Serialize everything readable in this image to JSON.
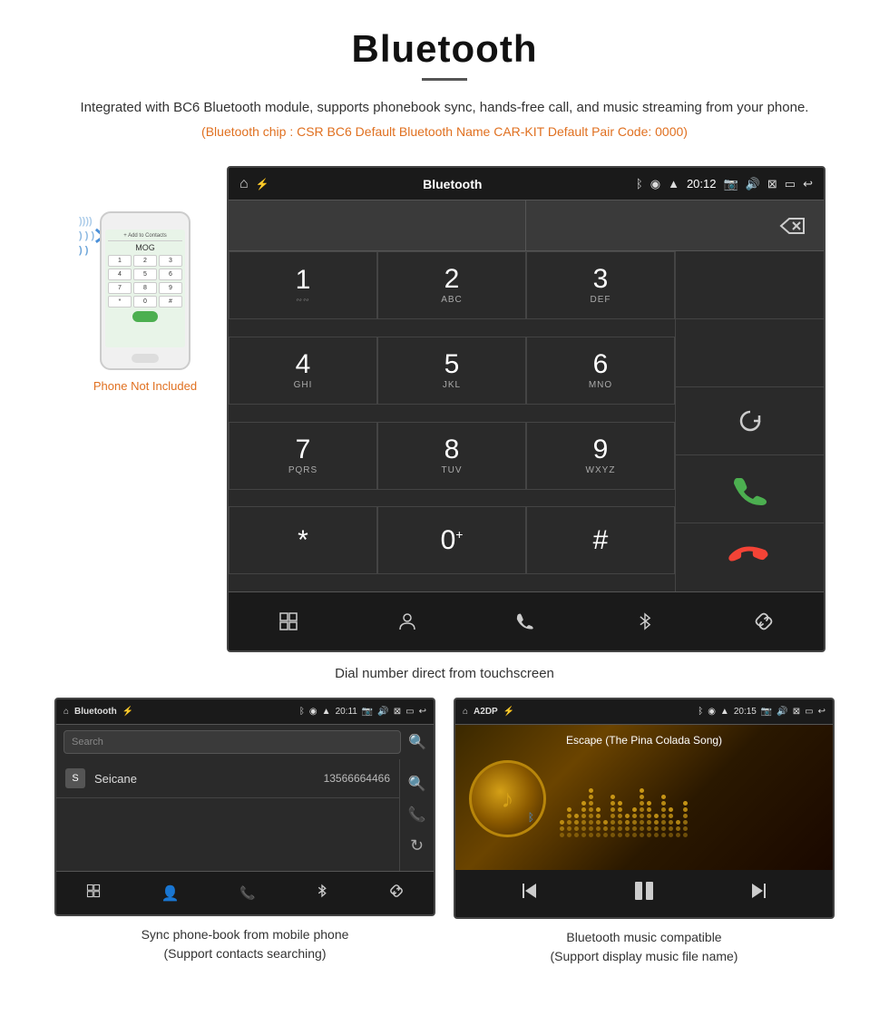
{
  "header": {
    "title": "Bluetooth",
    "description": "Integrated with BC6 Bluetooth module, supports phonebook sync, hands-free call, and music streaming from your phone.",
    "specs": "(Bluetooth chip : CSR BC6    Default Bluetooth Name CAR-KIT    Default Pair Code: 0000)"
  },
  "phone_sidebar": {
    "not_included": "Phone Not Included"
  },
  "dial_screen": {
    "title": "Bluetooth",
    "time": "20:12",
    "keys": [
      {
        "number": "1",
        "letters": ""
      },
      {
        "number": "2",
        "letters": "ABC"
      },
      {
        "number": "3",
        "letters": "DEF"
      },
      {
        "number": "4",
        "letters": "GHI"
      },
      {
        "number": "5",
        "letters": "JKL"
      },
      {
        "number": "6",
        "letters": "MNO"
      },
      {
        "number": "7",
        "letters": "PQRS"
      },
      {
        "number": "8",
        "letters": "TUV"
      },
      {
        "number": "9",
        "letters": "WXYZ"
      },
      {
        "number": "*",
        "letters": ""
      },
      {
        "number": "0",
        "letters": "+"
      },
      {
        "number": "#",
        "letters": ""
      }
    ]
  },
  "dial_caption": "Dial number direct from touchscreen",
  "phonebook_screen": {
    "title": "Bluetooth",
    "time": "20:11",
    "search_placeholder": "Search",
    "contact_letter": "S",
    "contact_name": "Seicane",
    "contact_number": "13566664466"
  },
  "music_screen": {
    "title": "A2DP",
    "time": "20:15",
    "song_title": "Escape (The Pina Colada Song)"
  },
  "captions": {
    "phonebook": "Sync phone-book from mobile phone",
    "phonebook_sub": "(Support contacts searching)",
    "music": "Bluetooth music compatible",
    "music_sub": "(Support display music file name)"
  },
  "navbar_icons": {
    "grid": "⊞",
    "person": "👤",
    "phone": "📞",
    "bluetooth": "ᛒ",
    "link": "🔗"
  }
}
